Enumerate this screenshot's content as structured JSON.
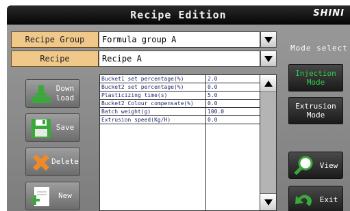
{
  "header": {
    "title": "Recipe Edition",
    "logo": "SHINI"
  },
  "recipe_group": {
    "label": "Recipe Group",
    "value": "Formula group A"
  },
  "recipe": {
    "label": "Recipe",
    "value": "Recipe A"
  },
  "actions": {
    "download": "Down\nload",
    "save": "Save",
    "delete": "Delete",
    "new": "New"
  },
  "table": {
    "rows": [
      {
        "param": "Bucket1 set percentage(%)",
        "value": "2.0"
      },
      {
        "param": "Bucket2 set percentage(%)",
        "value": "0.0"
      },
      {
        "param": "Plasticizing time(s)",
        "value": "5.0"
      },
      {
        "param": "Bucket2 Colour compensate(%)",
        "value": "0.0"
      },
      {
        "param": "Batch weight(g)",
        "value": "100.0"
      },
      {
        "param": "Extrusion speed(Kg/H)",
        "value": "0.0"
      }
    ]
  },
  "mode": {
    "label": "Mode select",
    "injection": "Injection\nMode",
    "extrusion": "Extrusion\nMode"
  },
  "nav": {
    "view": "View",
    "exit": "Exit"
  },
  "colors": {
    "injection_text": "#2fd04a",
    "extrusion_text": "#ffffff",
    "label_bg": "#f0c88a"
  }
}
